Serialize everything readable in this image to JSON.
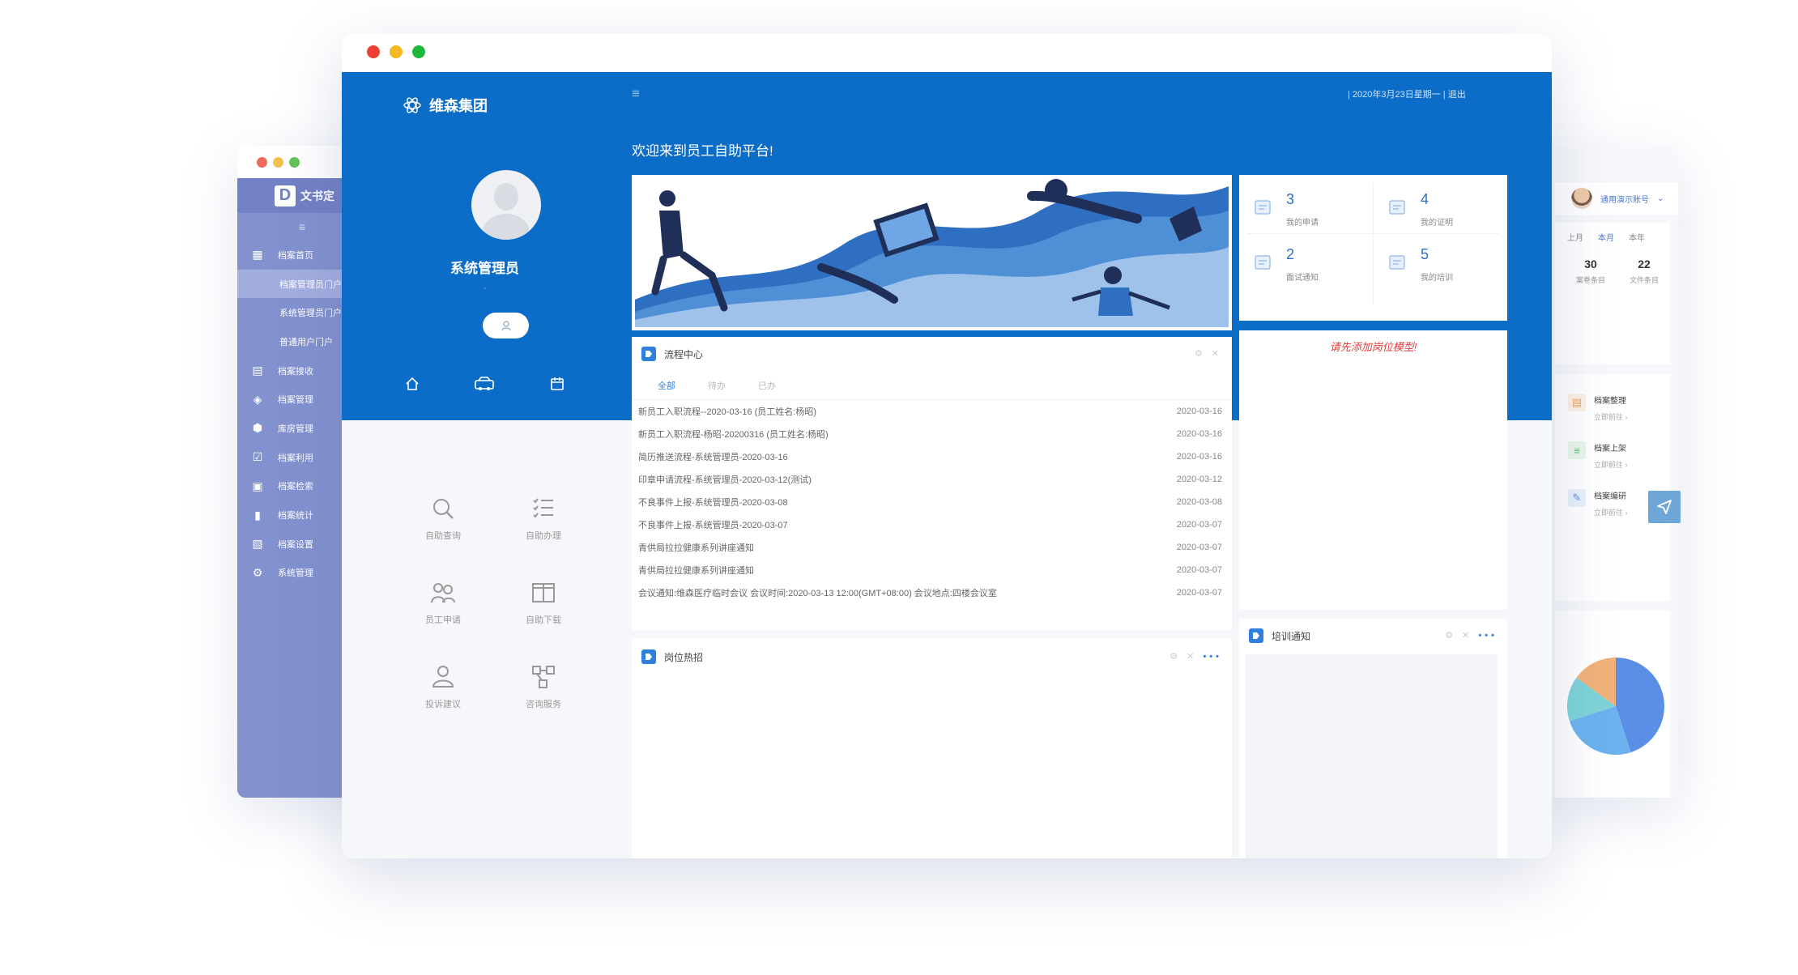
{
  "main": {
    "brand_name": "维森集团",
    "user_name": "系统管理员",
    "user_role": "-",
    "menu_toggle": "≡",
    "topbar_right": "| 2020年3月23日星期一 | 退出",
    "welcome": "欢迎来到员工自助平台!",
    "stats": [
      {
        "num": "3",
        "label": "我的申请",
        "icon": "application-icon"
      },
      {
        "num": "4",
        "label": "我的证明",
        "icon": "certificate-icon"
      },
      {
        "num": "2",
        "label": "面试通知",
        "icon": "interview-icon"
      },
      {
        "num": "5",
        "label": "我的培训",
        "icon": "training-icon"
      }
    ],
    "quick_menu": [
      {
        "label": "自助查询",
        "icon": "search-icon"
      },
      {
        "label": "自助办理",
        "icon": "checklist-icon"
      },
      {
        "label": "员工申请",
        "icon": "people-icon"
      },
      {
        "label": "自助下载",
        "icon": "book-icon"
      },
      {
        "label": "投诉建议",
        "icon": "feedback-icon"
      },
      {
        "label": "咨询服务",
        "icon": "network-icon"
      }
    ],
    "process": {
      "title": "流程中心",
      "tabs": [
        "全部",
        "待办",
        "已办"
      ],
      "rows": [
        {
          "name": "新员工入职流程--2020-03-16 (员工姓名:杨昭)",
          "date": "2020-03-16"
        },
        {
          "name": "新员工入职流程-杨昭-20200316 (员工姓名:杨昭)",
          "date": "2020-03-16"
        },
        {
          "name": "简历推送流程-系统管理员-2020-03-16",
          "date": "2020-03-16"
        },
        {
          "name": "印章申请流程-系统管理员-2020-03-12(测试)",
          "date": "2020-03-12"
        },
        {
          "name": "不良事件上报-系统管理员-2020-03-08",
          "date": "2020-03-08"
        },
        {
          "name": "不良事件上报-系统管理员-2020-03-07",
          "date": "2020-03-07"
        },
        {
          "name": "青供局拉拉健康系列讲座通知",
          "date": "2020-03-07"
        },
        {
          "name": "青供局拉拉健康系列讲座通知",
          "date": "2020-03-07"
        },
        {
          "name": "会议通知:维森医疗临时会议 会议时间:2020-03-13 12:00(GMT+08:00) 会议地点:四楼会议室",
          "date": "2020-03-07"
        }
      ]
    },
    "warning": "请先添加岗位模型!",
    "job_card_title": "岗位热招",
    "train_card_title": "培训通知",
    "card_tools": "⚙ ✕"
  },
  "left_app": {
    "logo_letter": "D",
    "logo_text": "文书定",
    "menu_toggle": "≡",
    "items": [
      {
        "label": "档案首页",
        "sub": false,
        "icon": "▦"
      },
      {
        "label": "档案管理员门户",
        "sub": true,
        "active": true
      },
      {
        "label": "系统管理员门户",
        "sub": true
      },
      {
        "label": "普通用户门户",
        "sub": true
      },
      {
        "label": "档案接收",
        "sub": false,
        "icon": "▤"
      },
      {
        "label": "档案管理",
        "sub": false,
        "icon": "◈"
      },
      {
        "label": "库房管理",
        "sub": false,
        "icon": "⬢"
      },
      {
        "label": "档案利用",
        "sub": false,
        "icon": "☑"
      },
      {
        "label": "档案检索",
        "sub": false,
        "icon": "▣"
      },
      {
        "label": "档案统计",
        "sub": false,
        "icon": "▮"
      },
      {
        "label": "档案设置",
        "sub": false,
        "icon": "▧"
      },
      {
        "label": "系统管理",
        "sub": false,
        "icon": "⚙"
      }
    ]
  },
  "right_app": {
    "account": "通用演示账号",
    "periods": [
      "上月",
      "本月",
      "本年"
    ],
    "stat1": {
      "num": "30",
      "label": "案卷条目"
    },
    "stat2": {
      "num": "22",
      "label": "文件条目"
    },
    "actions": [
      {
        "title": "档案整理",
        "sub": "立即前往 ›",
        "color": "#f2a55a",
        "bg": "#fdf0e4"
      },
      {
        "title": "档案上架",
        "sub": "立即前往 ›",
        "color": "#5cbf6a",
        "bg": "#e8f6ea"
      },
      {
        "title": "档案编研",
        "sub": "立即前往 ›",
        "color": "#5b8fdc",
        "bg": "#e8f0fc"
      }
    ],
    "pie": [
      {
        "value": 45,
        "color": "#5b8fe6"
      },
      {
        "value": 25,
        "color": "#6cb2ee"
      },
      {
        "value": 15,
        "color": "#7ed3d8"
      },
      {
        "value": 15,
        "color": "#f1b179"
      }
    ]
  }
}
